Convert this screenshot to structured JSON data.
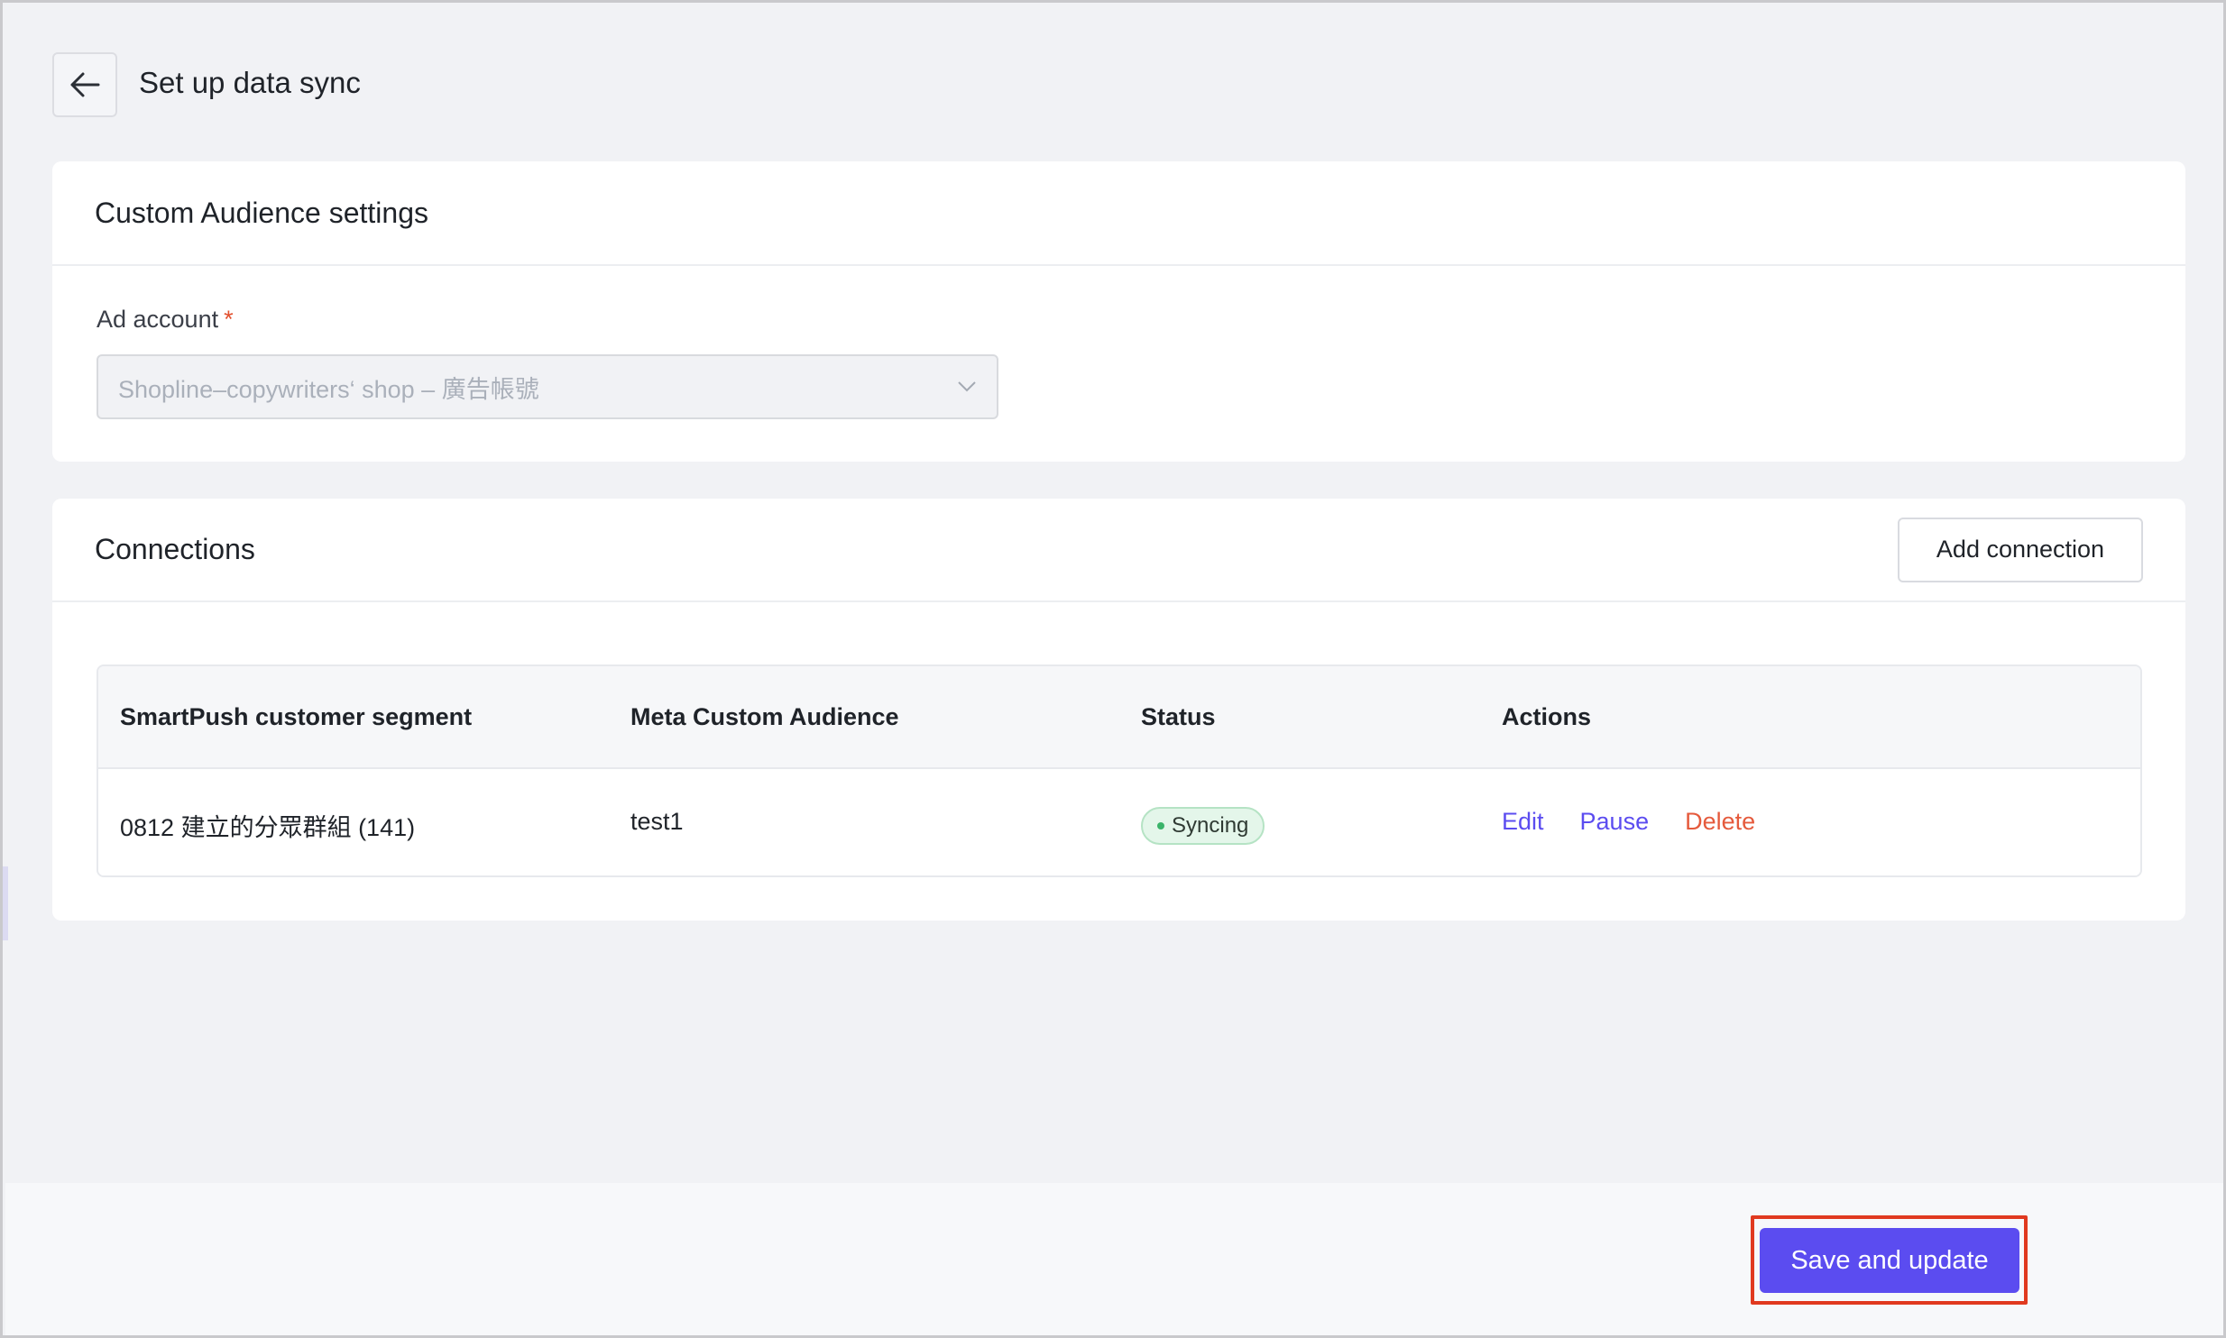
{
  "header": {
    "back_icon": "arrow-left-icon",
    "title": "Set up data sync"
  },
  "audience_settings": {
    "title": "Custom Audience settings",
    "ad_account": {
      "label": "Ad account",
      "required_mark": "*",
      "value": "Shopline–copywriters‘ shop – 廣告帳號",
      "dropdown_icon": "chevron-down-icon"
    }
  },
  "connections": {
    "title": "Connections",
    "add_button_label": "Add connection",
    "columns": [
      "SmartPush customer segment",
      "Meta Custom Audience",
      "Status",
      "Actions"
    ],
    "rows": [
      {
        "segment": "0812 建立的分眾群組 (141)",
        "audience": "test1",
        "status": "Syncing",
        "status_color": "#3bb46a",
        "actions": [
          "Edit",
          "Pause",
          "Delete"
        ]
      }
    ]
  },
  "footer": {
    "save_label": "Save and update",
    "accent_color": "#5b4cf0",
    "highlight_color": "#e0391f"
  }
}
